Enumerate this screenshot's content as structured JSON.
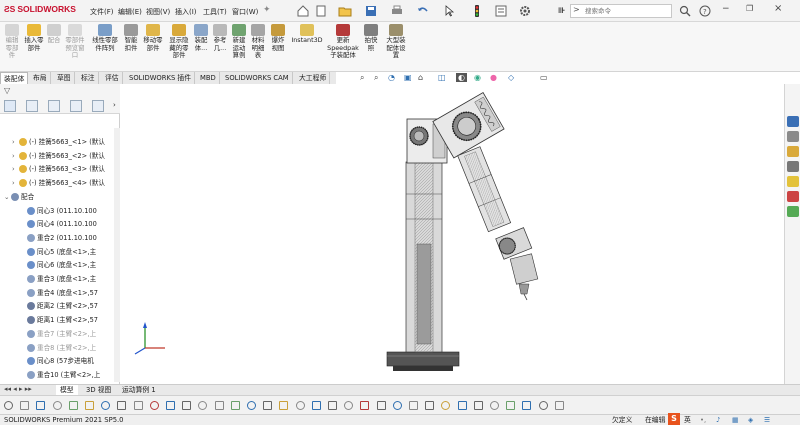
{
  "app": {
    "brand": "SOLIDWORKS",
    "status_text": "SOLIDWORKS Premium 2021 SP5.0"
  },
  "menu": [
    "文件(F)",
    "编辑(E)",
    "视图(V)",
    "插入(I)",
    "工具(T)",
    "窗口(W)"
  ],
  "search": {
    "placeholder": "搜索命令"
  },
  "ribbon": [
    {
      "label": "编辑\n零部\n件",
      "enabled": false
    },
    {
      "label": "插入零\n部件",
      "enabled": true
    },
    {
      "label": "配合",
      "enabled": false
    },
    {
      "label": "零部件\n预览窗\n口",
      "enabled": false
    },
    {
      "label": "线性零部\n件阵列",
      "enabled": true
    },
    {
      "label": "智能\n扣件",
      "enabled": true
    },
    {
      "label": "移动零\n部件",
      "enabled": true
    },
    {
      "label": "显示隐\n藏的零\n部件",
      "enabled": true
    },
    {
      "label": "装配\n体...",
      "enabled": true
    },
    {
      "label": "参考\n几...",
      "enabled": true
    },
    {
      "label": "新建\n运动\n算例",
      "enabled": true
    },
    {
      "label": "材料\n明细\n表",
      "enabled": true
    },
    {
      "label": "爆炸\n视图",
      "enabled": true
    },
    {
      "label": "Instant3D",
      "enabled": true
    },
    {
      "label": "更新\nSpeedpak\n子装配体",
      "enabled": true
    },
    {
      "label": "拍快\n照",
      "enabled": true
    },
    {
      "label": "大型装\n配体设\n置",
      "enabled": true
    }
  ],
  "command_tabs": [
    "装配体",
    "布局",
    "草图",
    "标注",
    "评估",
    "SOLIDWORKS 插件",
    "MBD",
    "SOLIDWORKS CAM",
    "大工程师"
  ],
  "tree": [
    {
      "label": "(-) 挂簧5663_<1> (默认",
      "type": "part",
      "indent": 1,
      "gray": false
    },
    {
      "label": "(-) 挂簧5663_<2> (默认",
      "type": "part",
      "indent": 1,
      "gray": false
    },
    {
      "label": "(-) 挂簧5663_<3> (默认",
      "type": "part",
      "indent": 1,
      "gray": false
    },
    {
      "label": "(-) 挂簧5663_<4> (默认",
      "type": "part",
      "indent": 1,
      "gray": false
    },
    {
      "label": "配合",
      "type": "mates",
      "indent": 0,
      "gray": false
    },
    {
      "label": "同心3 (011.10.100",
      "type": "concentric",
      "indent": 2,
      "gray": false
    },
    {
      "label": "同心4 (011.10.100",
      "type": "concentric",
      "indent": 2,
      "gray": false
    },
    {
      "label": "重合2 (011.10.100",
      "type": "coincident",
      "indent": 2,
      "gray": false
    },
    {
      "label": "同心5 (底盘<1>,主",
      "type": "concentric",
      "indent": 2,
      "gray": false
    },
    {
      "label": "同心6 (底盘<1>,主",
      "type": "concentric",
      "indent": 2,
      "gray": false
    },
    {
      "label": "重合3 (底盘<1>,主",
      "type": "coincident",
      "indent": 2,
      "gray": false
    },
    {
      "label": "重合4 (底盘<1>,57",
      "type": "coincident",
      "indent": 2,
      "gray": false
    },
    {
      "label": "距离2 (主臂<2>,57",
      "type": "distance",
      "indent": 2,
      "gray": false
    },
    {
      "label": "距离1 (主臂<2>,57",
      "type": "distance",
      "indent": 2,
      "gray": false
    },
    {
      "label": "重合7 (主臂<2>,上",
      "type": "coincident",
      "indent": 2,
      "gray": true
    },
    {
      "label": "重合8 (主臂<2>,上",
      "type": "coincident",
      "indent": 2,
      "gray": true
    },
    {
      "label": "同心8 (57步进电机",
      "type": "concentric",
      "indent": 2,
      "gray": false
    },
    {
      "label": "重合10 (主臂<2>,上",
      "type": "coincident",
      "indent": 2,
      "gray": false
    }
  ],
  "bottom_tabs": [
    "模型",
    "3D 视图",
    "运动算例 1"
  ],
  "status": {
    "under_defined": "欠定义",
    "editing": "在编辑",
    "ime": "英"
  },
  "colors": {
    "brand_red": "#c8102e",
    "accent_blue": "#1f5fa8"
  }
}
